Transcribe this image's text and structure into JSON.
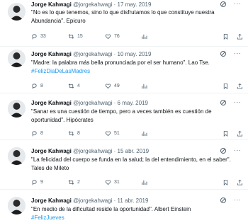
{
  "tweets": [
    {
      "name": "Jorge Kahwagi",
      "handle": "@jorgekahwagi",
      "date": "17 may. 2019",
      "text": "\"No es lo que tenemos, sino lo que disfrutamos lo que constituye nuestra Abundancia\". Epicuro",
      "hashtag": "",
      "replies": "33",
      "retweets": "15",
      "likes": "76"
    },
    {
      "name": "Jorge Kahwagi",
      "handle": "@jorgekahwagi",
      "date": "10 may. 2019",
      "text": "\"Madre: la palabra más bella pronunciada por el ser humano\". Lao Tse.",
      "hashtag": "#FelizDiaDeLasMadres",
      "replies": "8",
      "retweets": "4",
      "likes": "49"
    },
    {
      "name": "Jorge Kahwagi",
      "handle": "@jorgekahwagi",
      "date": "6 may. 2019",
      "text": "\"Sanar es una cuestión de tiempo, pero a veces también es cuestión de oportunidad\". Hipócrates",
      "hashtag": "",
      "replies": "8",
      "retweets": "8",
      "likes": "51"
    },
    {
      "name": "Jorge Kahwagi",
      "handle": "@jorgekahwagi",
      "date": "15 abr. 2019",
      "text": "\"La felicidad del cuerpo se funda en la salud; la del entendimiento, en el saber\". Tales de Mileto",
      "hashtag": "",
      "replies": "9",
      "retweets": "2",
      "likes": "31"
    },
    {
      "name": "Jorge Kahwagi",
      "handle": "@jorgekahwagi",
      "date": "11 abr. 2019",
      "text": "\"En medio de la dificultad reside la oportunidad\". Albert Einstein",
      "hashtag": "#FelizJueves",
      "replies": "",
      "retweets": "",
      "likes": ""
    }
  ],
  "separator": "·",
  "more_glyph": "···"
}
